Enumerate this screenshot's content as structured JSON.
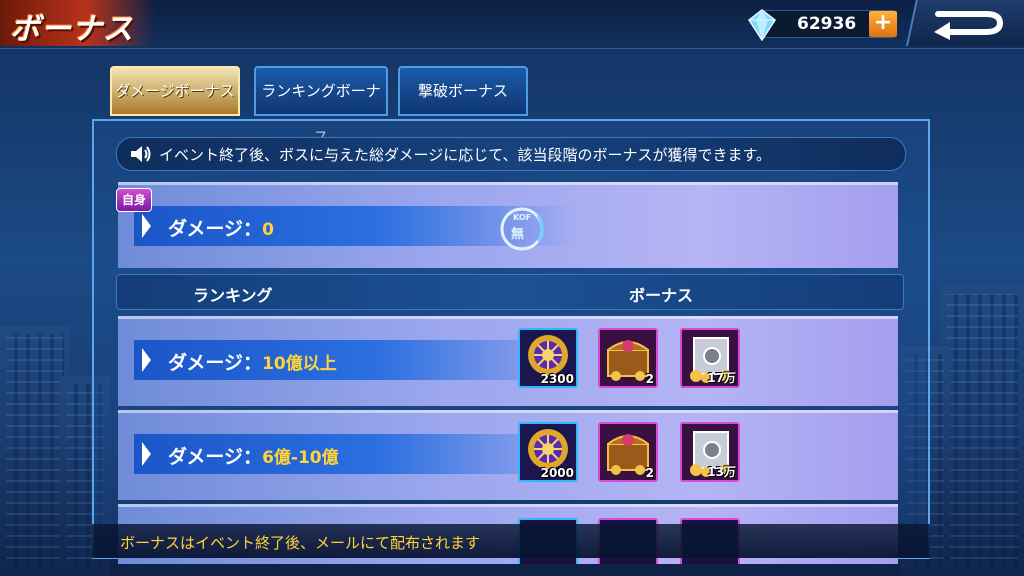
{
  "header": {
    "title": "ボーナス",
    "currency_value": "62936",
    "plus_label": "+"
  },
  "tabs": [
    {
      "label": "ダメージボーナス",
      "active": true
    },
    {
      "label": "ランキングボーナス",
      "active": false
    },
    {
      "label": "撃破ボーナス",
      "active": false
    }
  ],
  "notice": "イベント終了後、ボスに与えた総ダメージに応じて、該当段階のボーナスが獲得できます。",
  "my_damage": {
    "badge": "自身",
    "label": "ダメージ：",
    "value": "0",
    "stamp": "無"
  },
  "columns": {
    "ranking": "ランキング",
    "bonus": "ボーナス"
  },
  "rows": [
    {
      "label": "ダメージ：",
      "range": "10億以上",
      "rewards": [
        {
          "icon": "medal-icon",
          "count": "2300"
        },
        {
          "icon": "treasure-chest-icon",
          "count": "2"
        },
        {
          "icon": "gold-safe-icon",
          "count": "17万"
        }
      ]
    },
    {
      "label": "ダメージ：",
      "range": "6億-10億",
      "rewards": [
        {
          "icon": "medal-icon",
          "count": "2000"
        },
        {
          "icon": "treasure-chest-icon",
          "count": "2"
        },
        {
          "icon": "gold-safe-icon",
          "count": "13万"
        }
      ]
    }
  ],
  "footer_note": "ボーナスはイベント終了後、メールにて配布されます",
  "colors": {
    "accent_gold": "#ffd43a",
    "tab_active": "#c89a48",
    "panel_border": "#5aa8ea"
  }
}
